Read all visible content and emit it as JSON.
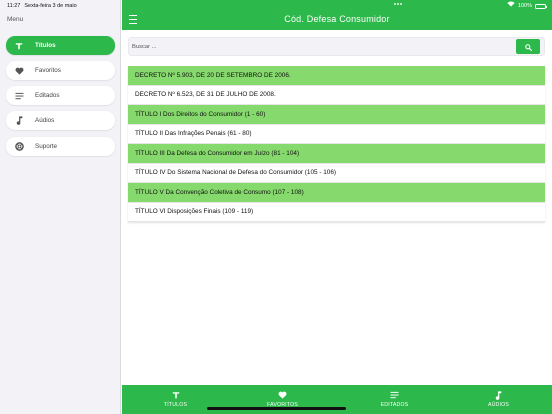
{
  "status_bar": {
    "time": "11:27",
    "date": "Sexta-feira 3 de maio",
    "battery": "100%"
  },
  "sidebar": {
    "title": "Menu",
    "items": [
      {
        "label": "Títulos",
        "icon": "text-t-icon",
        "active": true
      },
      {
        "label": "Favoritos",
        "icon": "heart-icon",
        "active": false
      },
      {
        "label": "Editados",
        "icon": "notes-lines-icon",
        "active": false
      },
      {
        "label": "Aúdios",
        "icon": "music-note-icon",
        "active": false
      },
      {
        "label": "Suporte",
        "icon": "lifebuoy-icon",
        "active": false
      }
    ]
  },
  "header": {
    "title": "Cód. Defesa Consumidor"
  },
  "search": {
    "placeholder": "Buscar ..."
  },
  "list": {
    "items": [
      "DECRETO Nº 5.903, DE 20 DE SETEMBRO DE 2006.",
      "DECRETO Nº 6.523, DE 31 DE JULHO DE 2008.",
      "TÍTULO I Dos Direitos do Consumidor (1 - 60)",
      "TÍTULO II Das Infrações Penais (61 - 80)",
      "TÍTULO III Da Defesa do Consumidor em Juízo (81 - 104)",
      "TÍTULO IV Do Sistema Nacional de Defesa do Consumidor (105 - 106)",
      "TÍTULO V Da Convenção Coletiva de Consumo (107 - 108)",
      "TÍTULO VI Disposições Finais (109 - 119)"
    ]
  },
  "tabbar": {
    "tabs": [
      {
        "label": "TÍTULOS",
        "icon": "text-t-icon"
      },
      {
        "label": "FAVORITOS",
        "icon": "heart-icon"
      },
      {
        "label": "EDITADOS",
        "icon": "notes-lines-icon"
      },
      {
        "label": "AÚDIOS",
        "icon": "music-note-icon"
      }
    ]
  },
  "colors": {
    "primary_green": "#2cb84a",
    "row_green": "#86d96c",
    "sidebar_bg": "#f2f2f7"
  }
}
